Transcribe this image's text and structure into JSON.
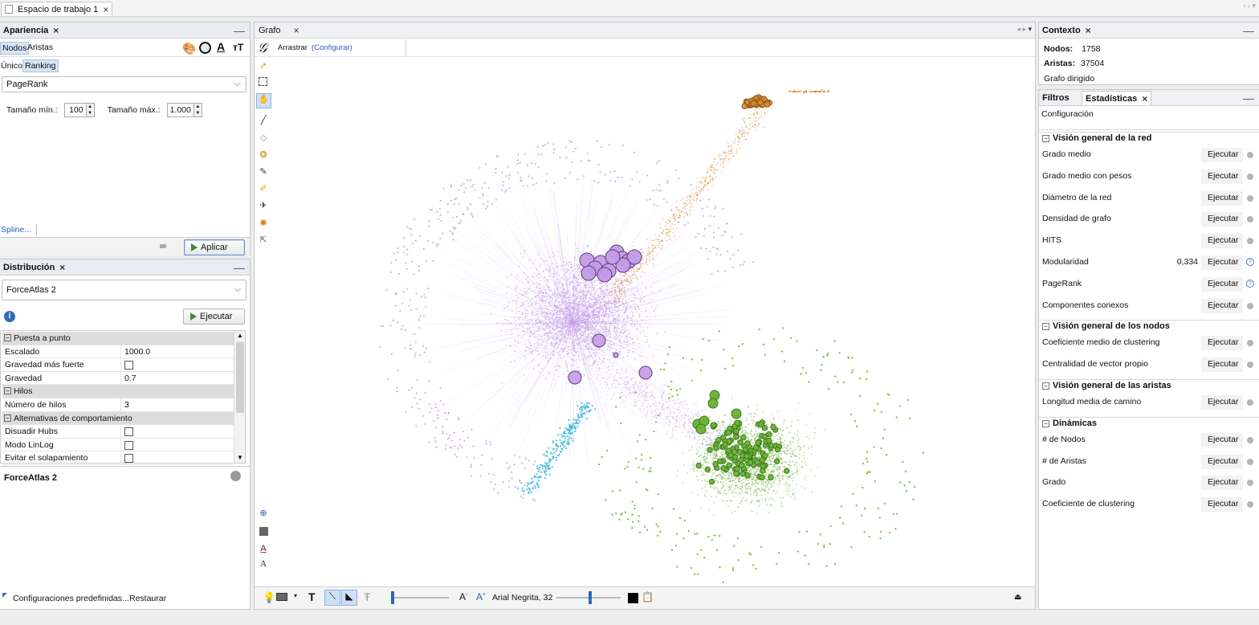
{
  "workspace_tab": "Espacio de trabajo 1",
  "appearance": {
    "title": "Apariencia",
    "tabs": [
      "Nodos",
      "Aristas"
    ],
    "subtabs": [
      "Único",
      "Ranking"
    ],
    "attribute": "PageRank",
    "min_label": "Tamaño mín.:",
    "min_value": "100",
    "max_label": "Tamaño máx.:",
    "max_value": "1.000",
    "spline": "Spline...",
    "apply": "Aplicar"
  },
  "layout": {
    "title": "Distribución",
    "algorithm": "ForceAtlas 2",
    "run": "Ejecutar",
    "props": [
      {
        "type": "cat",
        "label": "Puesta a punto"
      },
      {
        "type": "val",
        "label": "Escalado",
        "value": "1000.0"
      },
      {
        "type": "chk",
        "label": "Gravedad más fuerte"
      },
      {
        "type": "val",
        "label": "Gravedad",
        "value": "0.7"
      },
      {
        "type": "cat",
        "label": "Hilos"
      },
      {
        "type": "val",
        "label": "Número de hilos",
        "value": "3"
      },
      {
        "type": "cat",
        "label": "Alternativas de comportamiento"
      },
      {
        "type": "chk",
        "label": "Disuadir Hubs"
      },
      {
        "type": "chk",
        "label": "Modo LinLog"
      },
      {
        "type": "chk",
        "label": "Evitar el solapamiento"
      }
    ],
    "desc_title": "ForceAtlas 2",
    "presets": "Configuraciones predefinidas...",
    "restore": "Restaurar"
  },
  "graph": {
    "tab": "Grafo",
    "drag": "Arrastrar",
    "configure": "(Configurar)",
    "font": "Arial Negrita, 32"
  },
  "context": {
    "title": "Contexto",
    "nodes_label": "Nodos:",
    "nodes": "1758",
    "edges_label": "Aristas:",
    "edges": "37504",
    "type": "Grafo dirigido"
  },
  "stats": {
    "tabs": [
      "Filtros",
      "Estadísticas"
    ],
    "config": "Configuración",
    "run_label": "Ejecutar",
    "sections": [
      {
        "title": "Visión general de la red",
        "rows": [
          {
            "label": "Grado medio",
            "icon": "dot"
          },
          {
            "label": "Grado medio con pesos",
            "icon": "dot"
          },
          {
            "label": "Diámetro de la red",
            "icon": "dot"
          },
          {
            "label": "Densidad de grafo",
            "icon": "dot"
          },
          {
            "label": "HITS",
            "icon": "dot"
          },
          {
            "label": "Modularidad",
            "value": "0,334",
            "icon": "help"
          },
          {
            "label": "PageRank",
            "icon": "help"
          },
          {
            "label": "Componentes conexos",
            "icon": "dot"
          }
        ]
      },
      {
        "title": "Visión general de los nodos",
        "rows": [
          {
            "label": "Coeficiente medio de clustering",
            "icon": "dot"
          },
          {
            "label": "Centralidad de vector propio",
            "icon": "dot"
          }
        ]
      },
      {
        "title": "Visión general de las aristas",
        "rows": [
          {
            "label": "Longitud media de camino",
            "icon": "dot"
          }
        ]
      },
      {
        "title": "Dinámicas",
        "rows": [
          {
            "label": "# de Nodos",
            "icon": "dot"
          },
          {
            "label": "# de Aristas",
            "icon": "dot"
          },
          {
            "label": "Grado",
            "icon": "dot"
          },
          {
            "label": "Coeficiente de clustering",
            "icon": "dot"
          }
        ]
      }
    ]
  },
  "colors": {
    "purple": "#c39be6",
    "green": "#6fb43a",
    "cyan": "#3fb7d8",
    "orange": "#d98a32"
  }
}
